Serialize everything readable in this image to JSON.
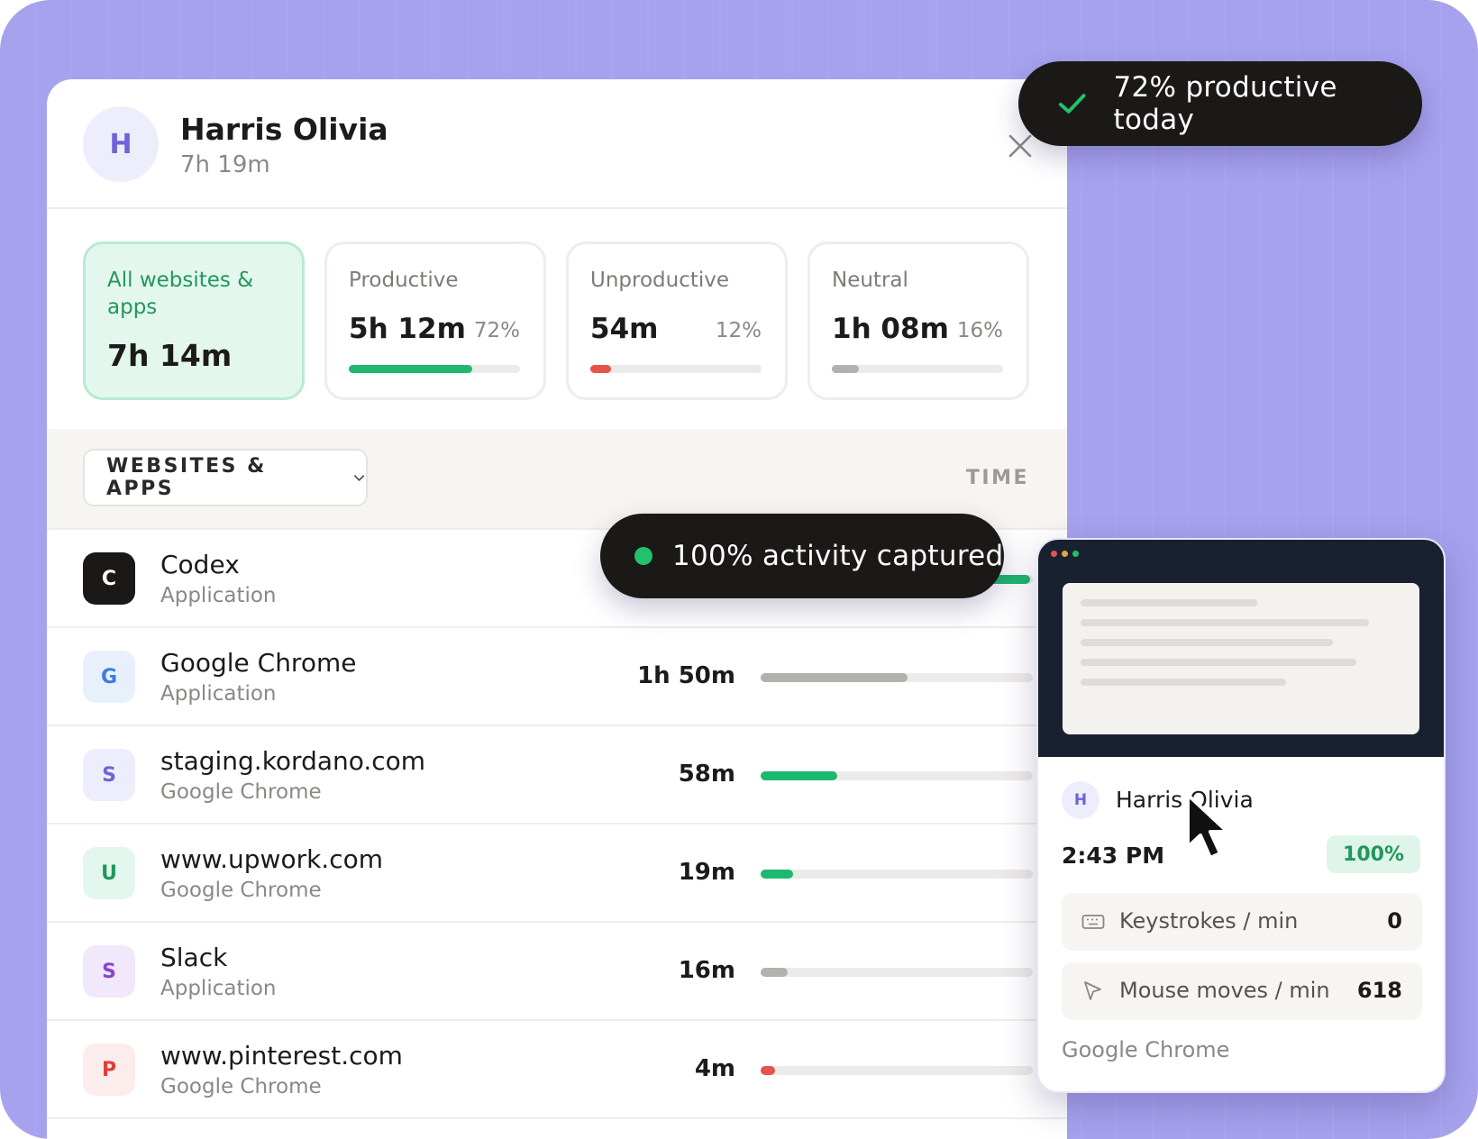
{
  "user": {
    "initial": "H",
    "name": "Harris Olivia",
    "total_time": "7h 19m"
  },
  "summary": {
    "all": {
      "label": "All websites & apps",
      "value": "7h 14m"
    },
    "productive": {
      "label": "Productive",
      "value": "5h 12m",
      "pct": "72%",
      "fill": 0.72,
      "color": "#1fb870"
    },
    "unproductive": {
      "label": "Unproductive",
      "value": "54m",
      "pct": "12%",
      "fill": 0.12,
      "color": "#e5534b"
    },
    "neutral": {
      "label": "Neutral",
      "value": "1h 08m",
      "pct": "16%",
      "fill": 0.16,
      "color": "#b3b1ad"
    }
  },
  "table": {
    "filter_label": "WEBSITES & APPS",
    "time_header": "TIME",
    "rows": [
      {
        "initial": "C",
        "name": "Codex",
        "sub": "Application",
        "time": "",
        "fill": 0.99,
        "bar": "#1fb870",
        "icon_bg": "#1a1917",
        "icon_fg": "#ffffff"
      },
      {
        "initial": "G",
        "name": "Google Chrome",
        "sub": "Application",
        "time": "1h 50m",
        "fill": 0.54,
        "bar": "#b3b1ad",
        "icon_bg": "#e8f0fc",
        "icon_fg": "#3d7ce0"
      },
      {
        "initial": "S",
        "name": "staging.kordano.com",
        "sub": "Google Chrome",
        "time": "58m",
        "fill": 0.28,
        "bar": "#1fb870",
        "icon_bg": "#eeedfb",
        "icon_fg": "#6e63d9"
      },
      {
        "initial": "U",
        "name": "www.upwork.com",
        "sub": "Google Chrome",
        "time": "19m",
        "fill": 0.12,
        "bar": "#1fb870",
        "icon_bg": "#e3f7ee",
        "icon_fg": "#21975c"
      },
      {
        "initial": "S",
        "name": "Slack",
        "sub": "Application",
        "time": "16m",
        "fill": 0.1,
        "bar": "#b3b1ad",
        "icon_bg": "#f1e9fb",
        "icon_fg": "#8a44cf"
      },
      {
        "initial": "P",
        "name": "www.pinterest.com",
        "sub": "Google Chrome",
        "time": "4m",
        "fill": 0.05,
        "bar": "#e5534b",
        "icon_bg": "#fdecec",
        "icon_fg": "#d9403a"
      }
    ]
  },
  "toasts": {
    "productive": "72% productive today",
    "activity": "100% activity captured"
  },
  "preview": {
    "initial": "H",
    "name": "Harris Olivia",
    "time": "2:43 PM",
    "activity_pct": "100%",
    "keystrokes_label": "Keystrokes / min",
    "keystrokes_value": "0",
    "mouse_label": "Mouse moves / min",
    "mouse_value": "618",
    "app": "Google Chrome"
  },
  "icons": {
    "close": "close-icon",
    "chevron": "chevron-down-icon",
    "check": "check-icon",
    "keyboard": "keyboard-icon",
    "cursor": "cursor-icon",
    "mouse_pointer": "mouse-pointer-icon"
  },
  "colors": {
    "background": "#a7a2ee",
    "accent_green": "#1fb870",
    "accent_red": "#e5534b",
    "accent_purple": "#6e63d9",
    "dark": "#1a1917"
  }
}
